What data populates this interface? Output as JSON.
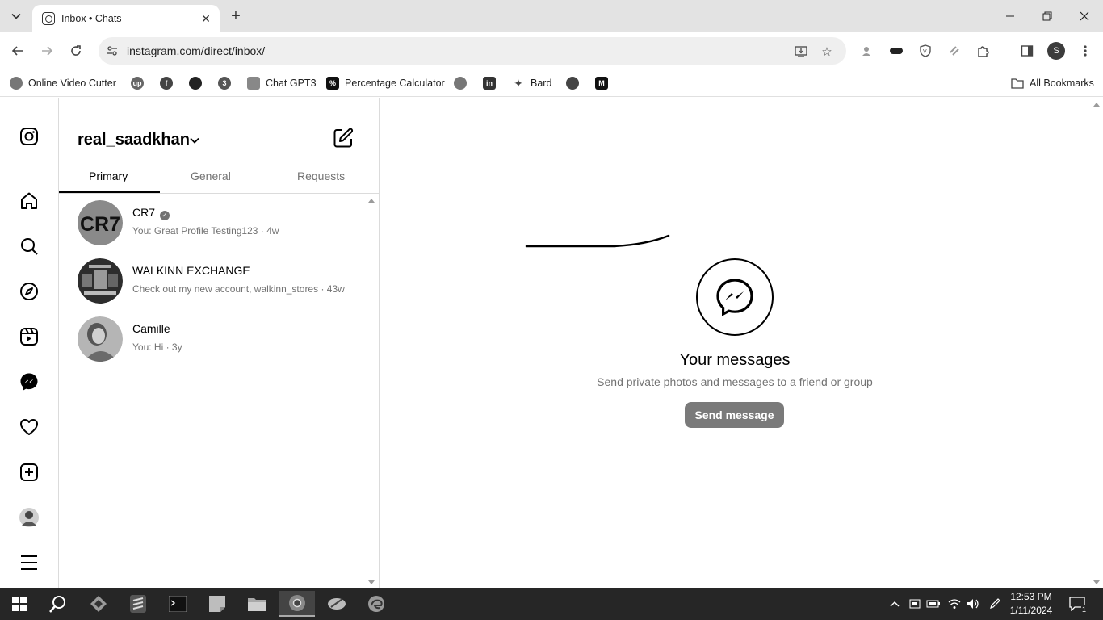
{
  "browser": {
    "tab_title": "Inbox • Chats",
    "url": "instagram.com/direct/inbox/",
    "profile_initial": "S",
    "bookmarks": [
      {
        "label": "Online Video Cutter"
      },
      {
        "label": ""
      },
      {
        "label": ""
      },
      {
        "label": ""
      },
      {
        "label": ""
      },
      {
        "label": "Chat GPT3"
      },
      {
        "label": "Percentage Calculator"
      },
      {
        "label": ""
      },
      {
        "label": ""
      },
      {
        "label": "Bard"
      },
      {
        "label": ""
      },
      {
        "label": ""
      }
    ],
    "all_bookmarks": "All Bookmarks"
  },
  "inbox": {
    "username": "real_saadkhan",
    "tabs": [
      {
        "label": "Primary",
        "active": true
      },
      {
        "label": "General",
        "active": false
      },
      {
        "label": "Requests",
        "active": false
      }
    ],
    "conversations": [
      {
        "name": "CR7",
        "verified": true,
        "snippet": "You: Great Profile Testing123 · 4w",
        "avatar_text": "CR7"
      },
      {
        "name": "WALKINN EXCHANGE",
        "verified": false,
        "snippet": "Check out my new account, walkinn_stores · 43w"
      },
      {
        "name": "Camille",
        "verified": false,
        "snippet": "You: Hi · 3y"
      }
    ]
  },
  "empty_state": {
    "title": "Your messages",
    "subtitle": "Send private photos and messages to a friend or group",
    "button": "Send message"
  },
  "taskbar": {
    "time": "12:53 PM",
    "date": "1/11/2024",
    "notifications": "1"
  },
  "colors": {
    "divider": "#dbdbdb",
    "secondary_text": "#737373",
    "button_bg": "#7a7a7a"
  }
}
